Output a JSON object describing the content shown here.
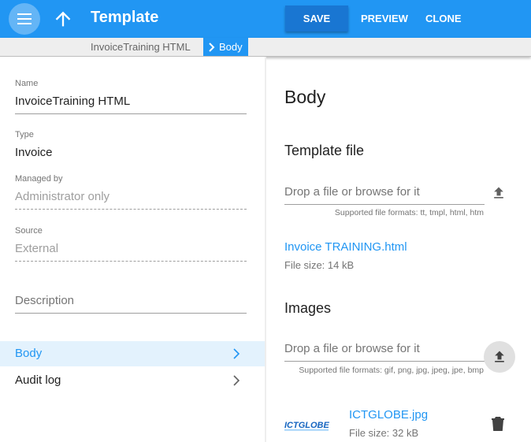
{
  "topbar": {
    "title": "Template",
    "save_label": "SAVE",
    "preview_label": "PREVIEW",
    "clone_label": "CLONE",
    "icons": [
      "hamburger-menu-icon",
      "arrow-up-icon"
    ]
  },
  "breadcrumb": {
    "parent": "InvoiceTraining HTML",
    "current": "Body"
  },
  "left": {
    "name_label": "Name",
    "name_value": "InvoiceTraining HTML",
    "type_label": "Type",
    "type_value": "Invoice",
    "managed_label": "Managed by",
    "managed_value": "Administrator only",
    "source_label": "Source",
    "source_value": "External",
    "description_placeholder": "Description",
    "nav": [
      {
        "label": "Body",
        "active": true
      },
      {
        "label": "Audit log",
        "active": false
      }
    ]
  },
  "right": {
    "title": "Body",
    "template_file": {
      "heading": "Template file",
      "drop_text": "Drop a file or browse for it",
      "hint": "Supported file formats: tt, tmpl, html, htm",
      "file_name": "Invoice TRAINING.html",
      "file_size": "File size: 14 kB"
    },
    "images": {
      "heading": "Images",
      "drop_text": "Drop a file or browse for it",
      "hint": "Supported file formats: gif, png, jpg, jpeg, jpe, bmp",
      "file_name": "ICTGLOBE.jpg",
      "file_size": "File size: 32 kB",
      "logo_text": "ICTGLOBE"
    }
  },
  "colors": {
    "primary": "#2196f3",
    "primary_dark": "#1976d2",
    "active_bg": "#e3f2fd"
  }
}
